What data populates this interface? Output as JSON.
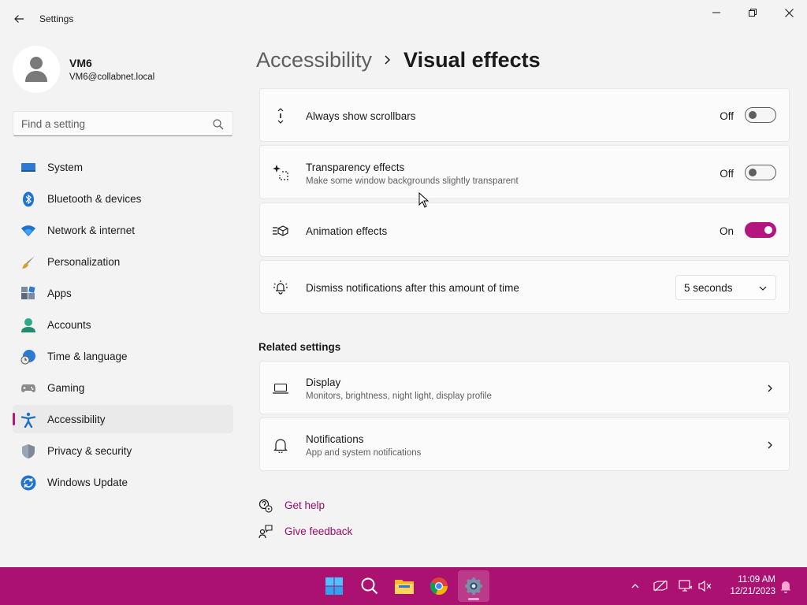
{
  "window": {
    "title": "Settings"
  },
  "profile": {
    "name": "VM6",
    "email": "VM6@collabnet.local"
  },
  "search": {
    "placeholder": "Find a setting"
  },
  "sidebar": {
    "items": [
      {
        "label": "System",
        "icon": "system-icon"
      },
      {
        "label": "Bluetooth & devices",
        "icon": "bluetooth-icon"
      },
      {
        "label": "Network & internet",
        "icon": "wifi-icon"
      },
      {
        "label": "Personalization",
        "icon": "brush-icon"
      },
      {
        "label": "Apps",
        "icon": "apps-icon"
      },
      {
        "label": "Accounts",
        "icon": "accounts-icon"
      },
      {
        "label": "Time & language",
        "icon": "globe-clock-icon"
      },
      {
        "label": "Gaming",
        "icon": "gamepad-icon"
      },
      {
        "label": "Accessibility",
        "icon": "accessibility-icon",
        "active": true
      },
      {
        "label": "Privacy & security",
        "icon": "shield-icon"
      },
      {
        "label": "Windows Update",
        "icon": "update-icon"
      }
    ]
  },
  "breadcrumb": {
    "parent": "Accessibility",
    "current": "Visual effects"
  },
  "settings": {
    "scrollbars": {
      "title": "Always show scrollbars",
      "state": "Off",
      "on": false
    },
    "transparency": {
      "title": "Transparency effects",
      "desc": "Make some window backgrounds slightly transparent",
      "state": "Off",
      "on": false
    },
    "animation": {
      "title": "Animation effects",
      "state": "On",
      "on": true
    },
    "notifications": {
      "title": "Dismiss notifications after this amount of time",
      "value": "5 seconds"
    }
  },
  "related": {
    "heading": "Related settings",
    "display": {
      "title": "Display",
      "desc": "Monitors, brightness, night light, display profile"
    },
    "notifications": {
      "title": "Notifications",
      "desc": "App and system notifications"
    }
  },
  "links": {
    "help": "Get help",
    "feedback": "Give feedback"
  },
  "taskbar": {
    "apps": [
      "start-icon",
      "search-icon",
      "file-explorer-icon",
      "chrome-icon",
      "settings-icon"
    ],
    "time": "11:09 AM",
    "date": "12/21/2023"
  },
  "colors": {
    "accent": "#b4157f",
    "taskbar": "#ab1170",
    "link": "#9a0d6a"
  }
}
